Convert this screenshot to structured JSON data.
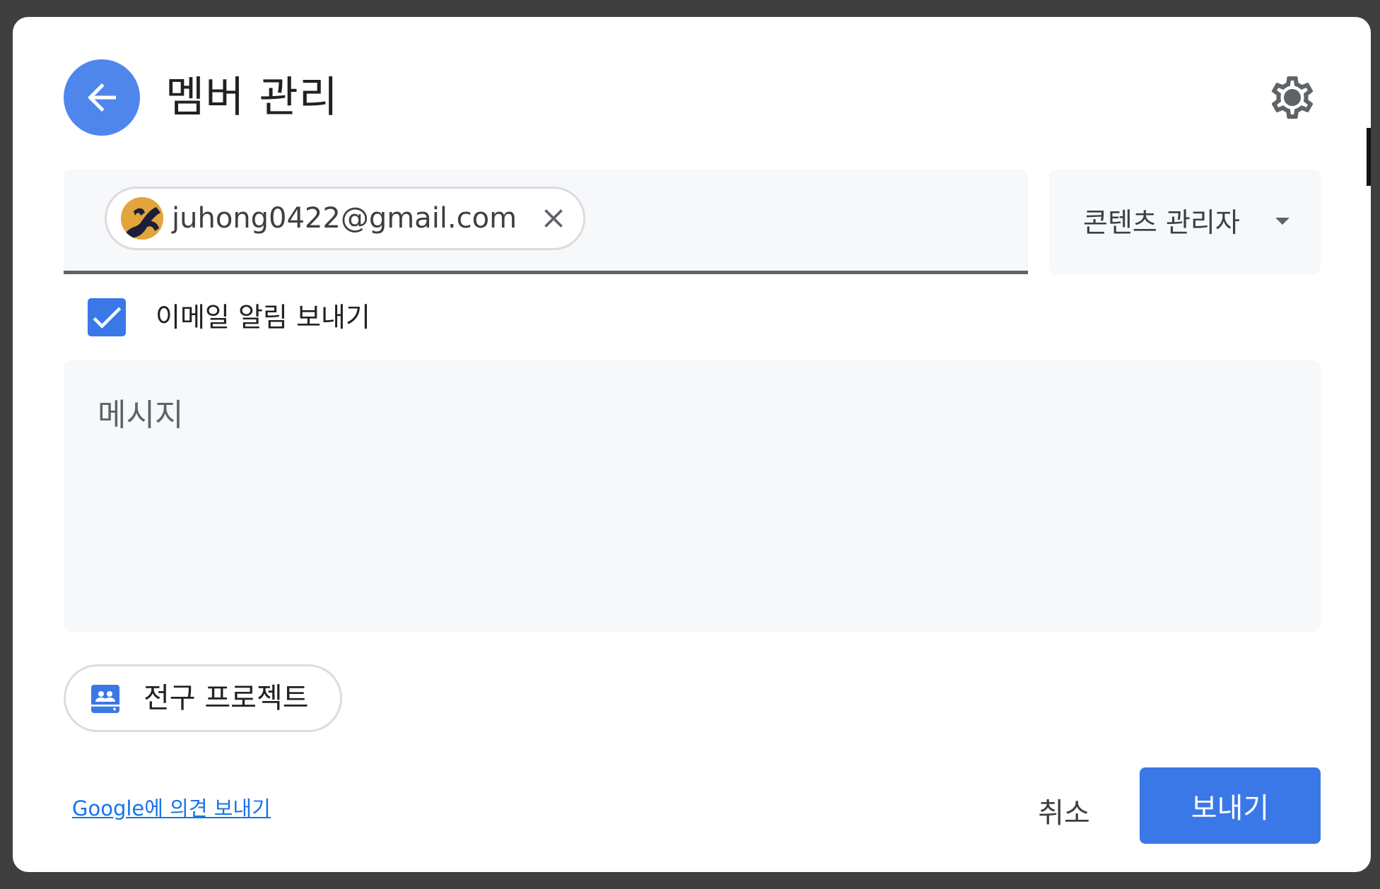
{
  "dialog": {
    "title": "멤버 관리",
    "icons": {
      "back": "arrow-back-icon",
      "settings": "gear-icon"
    }
  },
  "recipients": {
    "chips": [
      {
        "email": "juhong0422@gmail.com",
        "avatar_icon": "user-avatar",
        "remove_icon": "close-icon"
      }
    ]
  },
  "role": {
    "selected": "콘텐츠 관리자",
    "icon": "caret-down-icon"
  },
  "notify": {
    "label": "이메일 알림 보내기",
    "checked": true
  },
  "message": {
    "placeholder": "메시지"
  },
  "project": {
    "label": "전구 프로젝트",
    "icon": "people-folder-icon"
  },
  "footer": {
    "feedback_link": "Google에 의견 보내기",
    "cancel_label": "취소",
    "send_label": "보내기"
  },
  "colors": {
    "accent": "#3b78e7",
    "back_button": "#4f86ec",
    "field_background": "#f6f8fa",
    "link": "#1a73e8",
    "overlay": "#3f3f3f"
  }
}
